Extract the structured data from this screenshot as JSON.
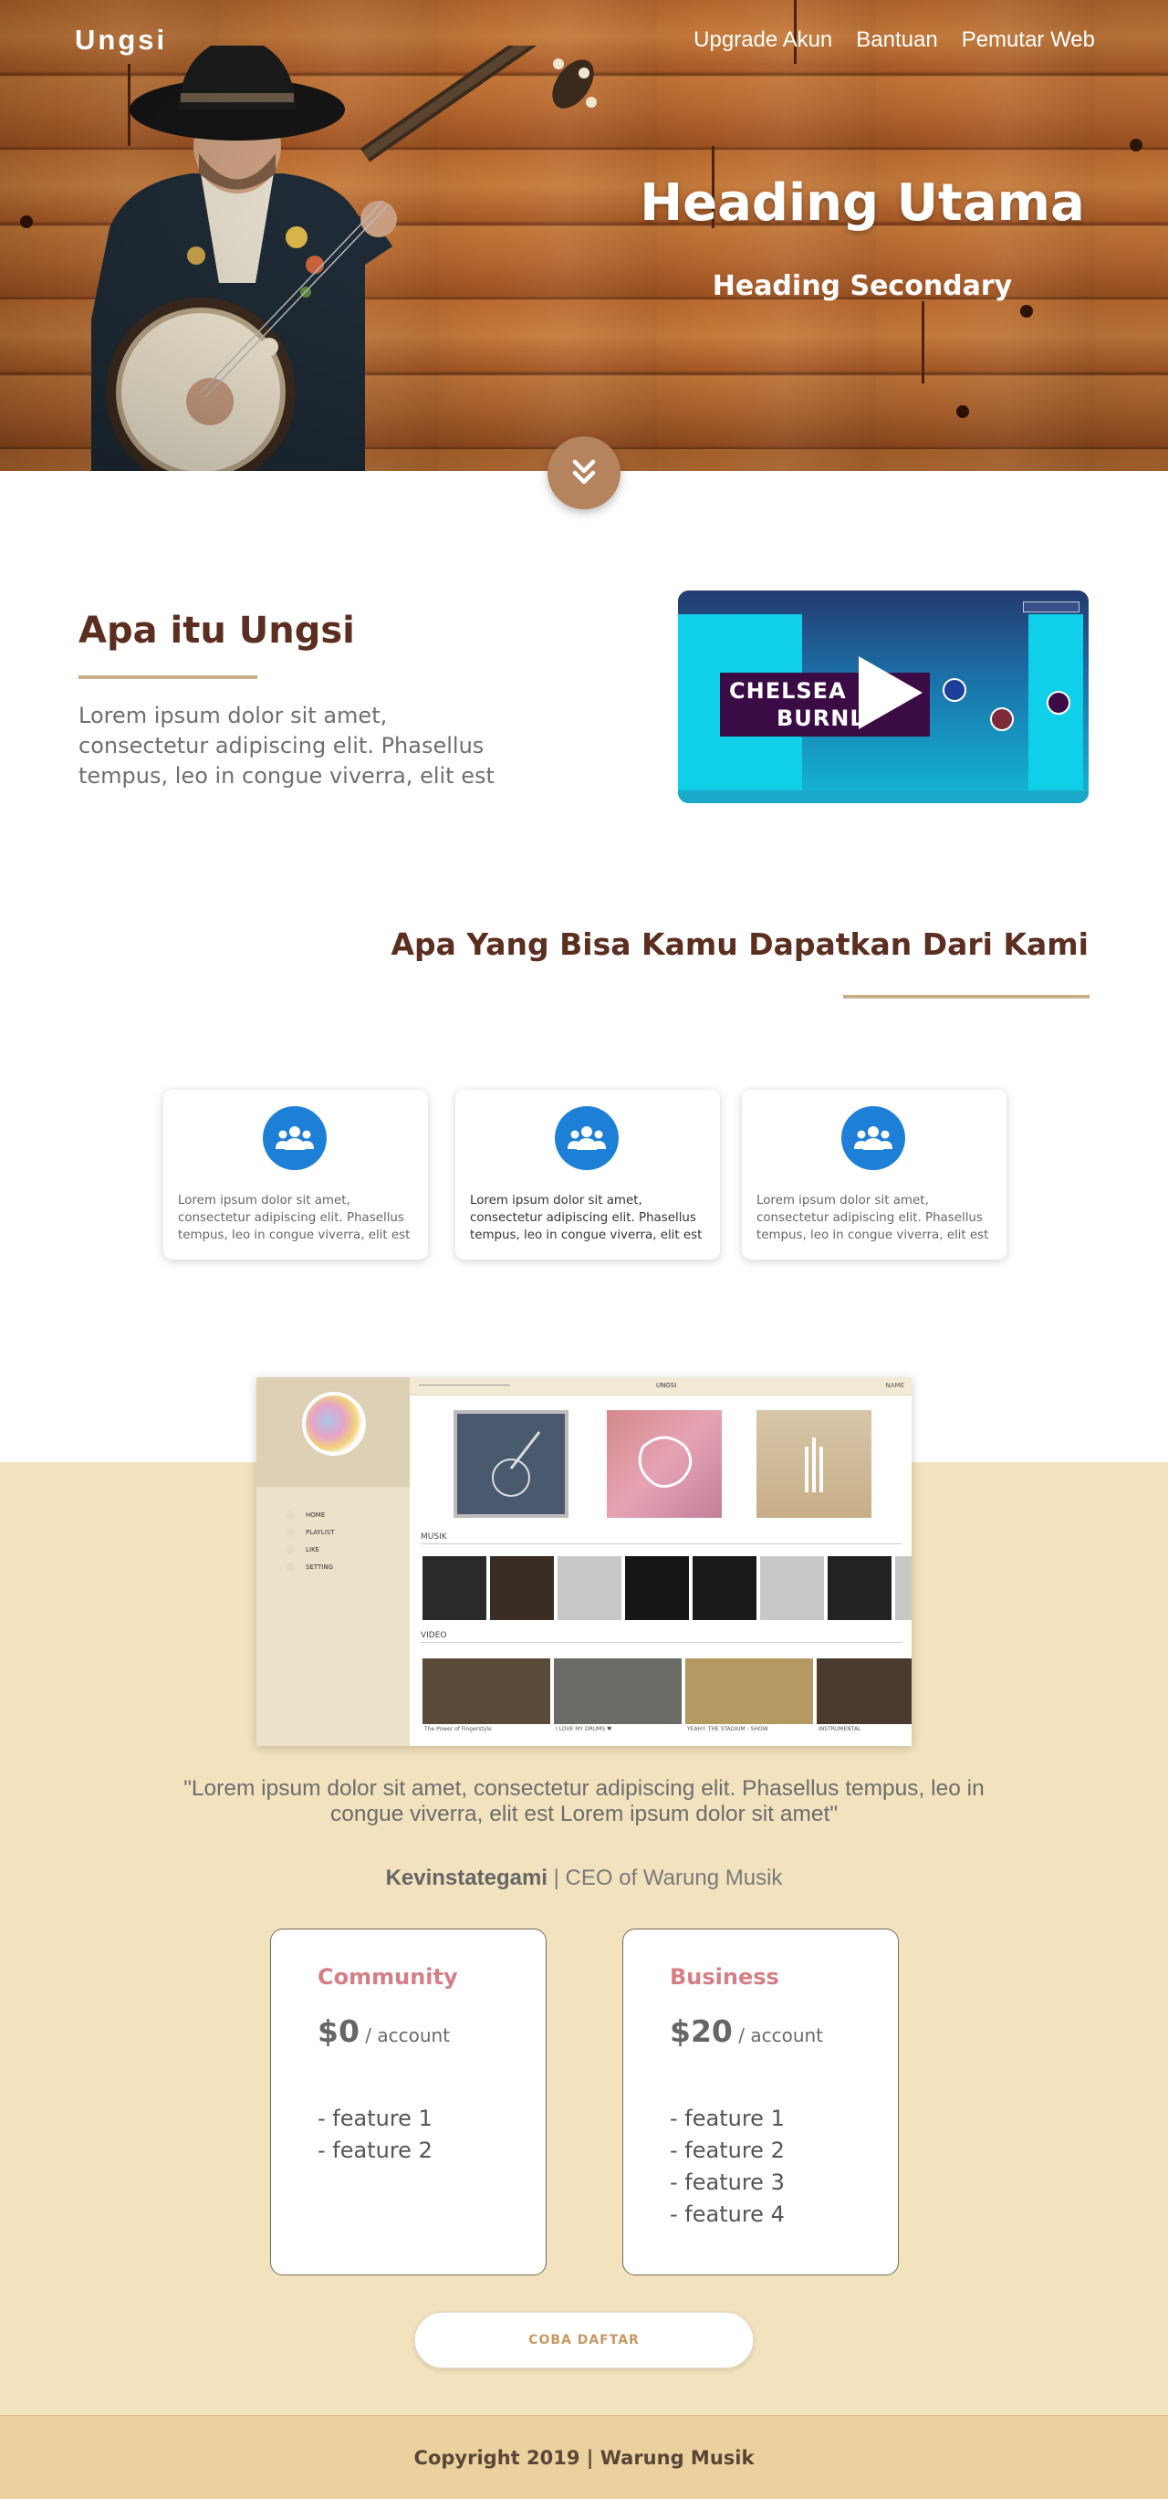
{
  "header": {
    "brand": "Ungsi",
    "nav": [
      "Upgrade Akun",
      "Bantuan",
      "Pemutar Web"
    ],
    "title": "Heading Utama",
    "subtitle": "Heading Secondary",
    "scroll_icon": "double-chevron-down-icon"
  },
  "about": {
    "title": "Apa itu Ungsi",
    "text": "Lorem ipsum dolor sit amet, consectetur adipiscing elit. Phasellus tempus, leo in congue viverra, elit est",
    "video": {
      "line1": "CHELSEA",
      "line2": "BURNL",
      "icon": "play-icon"
    }
  },
  "features": {
    "title": "Apa Yang Bisa Kamu Dapatkan Dari Kami",
    "icon": "users-icon",
    "cards": [
      {
        "text": "Lorem ipsum dolor sit amet, consectetur adipiscing elit. Phasellus tempus, leo in congue viverra, elit est"
      },
      {
        "text": "Lorem ipsum dolor sit amet, consectetur adipiscing elit. Phasellus tempus, leo in congue viverra, elit est"
      },
      {
        "text": "Lorem ipsum dolor sit amet, consectetur adipiscing elit. Phasellus tempus, leo in congue viverra, elit est"
      }
    ]
  },
  "mockup": {
    "app_title": "UNGSI",
    "user_name": "NAME",
    "side_menu": [
      "HOME",
      "PLAYLIST",
      "LIKE",
      "SETTING"
    ],
    "section_music": "MUSIK",
    "section_video": "VIDEO",
    "video_captions": [
      "The Power of Fingerstyle",
      "I LOVE MY DRUMS ♥",
      "YEAH!! THE STADIUM - SHOW",
      "INSTRUMENTAL"
    ]
  },
  "testimonial": {
    "quote": "\"Lorem ipsum dolor sit amet, consectetur adipiscing elit. Phasellus tempus, leo in congue viverra, elit est Lorem ipsum dolor sit amet\"",
    "author": "Kevinstategami",
    "role": "| CEO of Warung Musik"
  },
  "pricing": {
    "plans": [
      {
        "name": "Community",
        "price": "$0",
        "unit": "/ account",
        "features": [
          "- feature 1",
          "- feature 2"
        ]
      },
      {
        "name": "Business",
        "price": "$20",
        "unit": "/ account",
        "features": [
          "- feature 1",
          "- feature 2",
          "- feature 3",
          "- feature 4"
        ]
      }
    ],
    "cta": "COBA DAFTAR"
  },
  "footer": {
    "text": "Copyright 2019 | Warung Musik"
  },
  "colors": {
    "accent_brown": "#5b2e20",
    "divider_tan": "#c9b08a",
    "beige_bg": "#f2e2bd",
    "plan_name_pink": "#d47f86",
    "icon_blue": "#1e7fd6"
  }
}
